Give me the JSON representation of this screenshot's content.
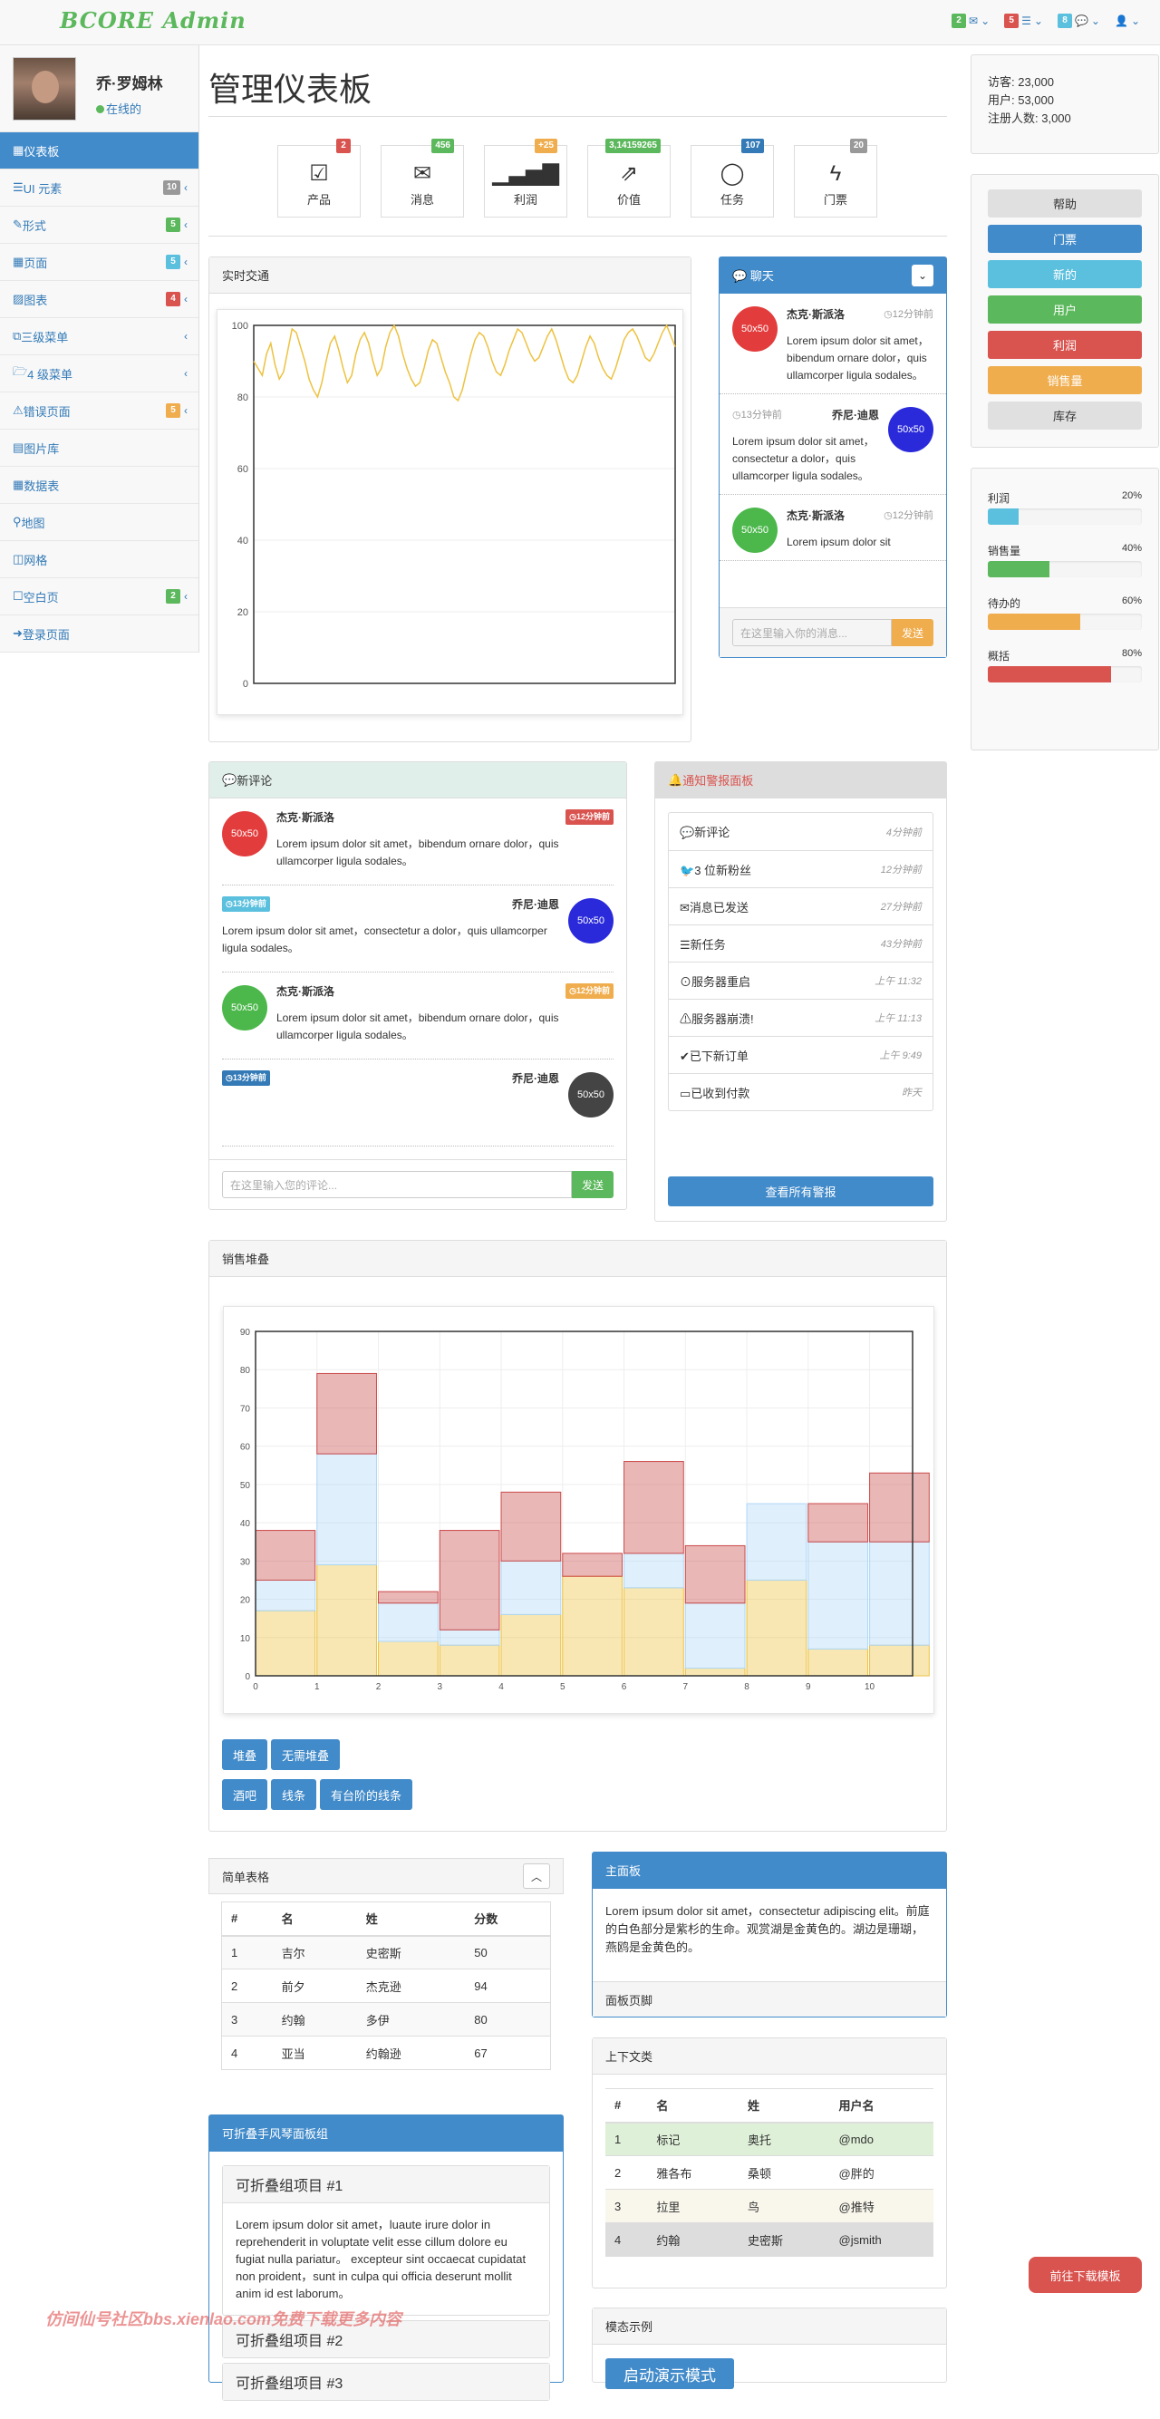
{
  "brand": "BCORE Admin",
  "topnav": [
    {
      "badge": "2",
      "color": "green",
      "icon": "envelope-icon"
    },
    {
      "badge": "5",
      "color": "red",
      "icon": "tasks-icon"
    },
    {
      "badge": "8",
      "color": "info",
      "icon": "comments-icon"
    },
    {
      "badge": "",
      "color": "",
      "icon": "user-icon"
    }
  ],
  "user": {
    "name": "乔·罗姆林",
    "status": "在线的"
  },
  "sidebar": [
    {
      "label": "仪表板",
      "icon": "table-icon",
      "active": true,
      "badge": "",
      "chevron": false
    },
    {
      "label": "UI 元素",
      "icon": "tasks-icon",
      "badge": "10",
      "badge_color": "gray",
      "chevron": true
    },
    {
      "label": "形式",
      "icon": "pencil-icon",
      "badge": "5",
      "badge_color": "green",
      "chevron": true
    },
    {
      "label": "页面",
      "icon": "table-icon",
      "badge": "5",
      "badge_color": "info",
      "chevron": true
    },
    {
      "label": "图表",
      "icon": "chart-icon",
      "badge": "4",
      "badge_color": "red",
      "chevron": true
    },
    {
      "label": "三级菜单",
      "icon": "sitemap-icon",
      "badge": "",
      "chevron": true
    },
    {
      "label": "4 级菜单",
      "icon": "folder-icon",
      "badge": "",
      "chevron": true
    },
    {
      "label": "错误页面",
      "icon": "warning-icon",
      "badge": "5",
      "badge_color": "yellow",
      "chevron": true
    },
    {
      "label": "图片库",
      "icon": "film-icon",
      "badge": "",
      "chevron": false
    },
    {
      "label": "数据表",
      "icon": "table-icon",
      "badge": "",
      "chevron": false
    },
    {
      "label": "地图",
      "icon": "map-marker-icon",
      "badge": "",
      "chevron": false
    },
    {
      "label": "网格",
      "icon": "columns-icon",
      "badge": "",
      "chevron": false
    },
    {
      "label": "空白页",
      "icon": "square-icon",
      "badge": "2",
      "badge_color": "green",
      "chevron": true
    },
    {
      "label": "登录页面",
      "icon": "sign-in-icon",
      "badge": "",
      "chevron": false
    }
  ],
  "page_title": "管理仪表板",
  "tiles": [
    {
      "label": "产品",
      "badge": "2",
      "color": "red",
      "icon": "check-icon",
      "glyph": "☑"
    },
    {
      "label": "消息",
      "badge": "456",
      "color": "green",
      "icon": "envelope-icon",
      "glyph": "✉"
    },
    {
      "label": "利润",
      "badge": "+25",
      "color": "yellow",
      "icon": "signal-icon",
      "glyph": "▁▃▅▇"
    },
    {
      "label": "价值",
      "badge": "3,14159265",
      "color": "green",
      "icon": "external-link-icon",
      "glyph": "⇗"
    },
    {
      "label": "任务",
      "badge": "107",
      "color": "blue",
      "icon": "comment-icon",
      "glyph": "◯"
    },
    {
      "label": "门票",
      "badge": "20",
      "color": "gray",
      "icon": "bolt-icon",
      "glyph": "ϟ"
    }
  ],
  "stats": {
    "visits": "访客: 23,000",
    "users": "用户: 53,000",
    "registered": "注册人数: 3,000"
  },
  "right_buttons": [
    {
      "label": "帮助",
      "color": "default"
    },
    {
      "label": "门票",
      "color": "blue"
    },
    {
      "label": "新的",
      "color": "info"
    },
    {
      "label": "用户",
      "color": "green"
    },
    {
      "label": "利润",
      "color": "red"
    },
    {
      "label": "销售量",
      "color": "yellow"
    },
    {
      "label": "库存",
      "color": "default"
    }
  ],
  "progress": [
    {
      "label": "利润",
      "value": 20,
      "text": "20%",
      "color": "#5bc0de"
    },
    {
      "label": "销售量",
      "value": 40,
      "text": "40%",
      "color": "#5cb85c"
    },
    {
      "label": "待办的",
      "value": 60,
      "text": "60%",
      "color": "#f0ad4e"
    },
    {
      "label": "概括",
      "value": 80,
      "text": "80%",
      "color": "#d9534f"
    }
  ],
  "realtime": {
    "title": "实时交通",
    "chart_data": {
      "type": "line",
      "title": "实时交通",
      "ylim": [
        0,
        100
      ],
      "yticks": [
        0,
        20,
        40,
        60,
        80,
        100
      ],
      "color": "#edc240",
      "values": [
        90,
        88,
        86,
        92,
        95,
        89,
        85,
        87,
        93,
        99,
        98,
        94,
        90,
        85,
        82,
        80,
        84,
        90,
        95,
        97,
        93,
        88,
        84,
        86,
        92,
        96,
        98,
        95,
        90,
        86,
        88,
        94,
        98,
        100,
        97,
        92,
        88,
        85,
        83,
        84,
        88,
        93,
        96,
        95,
        91,
        87,
        84,
        80,
        79,
        82,
        87,
        92,
        96,
        98,
        97,
        94,
        90,
        87,
        86,
        89,
        93,
        96,
        99,
        98,
        95,
        92,
        90,
        91,
        94,
        97,
        99,
        96,
        92,
        88,
        85,
        84,
        86,
        90,
        94,
        97,
        95,
        91,
        88,
        86,
        85,
        88,
        92,
        96,
        98,
        99,
        97,
        94,
        91,
        90,
        92,
        95,
        98,
        100,
        97,
        94
      ]
    }
  },
  "chat": {
    "title": "聊天",
    "messages": [
      {
        "name": "杰克·斯派洛",
        "time": "12分钟前",
        "text": "Lorem ipsum dolor sit amet，bibendum ornare dolor，quis ullamcorper ligula sodales。",
        "avatar": "50x50",
        "side": "left",
        "color": "red"
      },
      {
        "name": "乔尼·迪恩",
        "time": "13分钟前",
        "text": "Lorem ipsum dolor sit amet，consectetur a dolor，quis ullamcorper ligula sodales。",
        "avatar": "50x50",
        "side": "right",
        "color": "blue"
      },
      {
        "name": "杰克·斯派洛",
        "time": "12分钟前",
        "text": "Lorem ipsum dolor sit",
        "avatar": "50x50",
        "side": "left",
        "color": "green"
      }
    ],
    "input_placeholder": "在这里输入你的消息...",
    "send": "发送"
  },
  "comments": {
    "title": "新评论",
    "items": [
      {
        "name": "杰克·斯派洛",
        "time": "12分钟前",
        "text": "Lorem ipsum dolor sit amet，bibendum ornare dolor，quis ullamcorper ligula sodales。",
        "side": "left",
        "color": "red",
        "badge_color": "red"
      },
      {
        "name": "乔尼·迪恩",
        "time": "13分钟前",
        "text": "Lorem ipsum dolor sit amet，consectetur a dolor，quis ullamcorper ligula sodales。",
        "side": "right",
        "color": "blue",
        "badge_color": "info"
      },
      {
        "name": "杰克·斯派洛",
        "time": "12分钟前",
        "text": "Lorem ipsum dolor sit amet，bibendum ornare dolor，quis ullamcorper ligula sodales。",
        "side": "left",
        "color": "green",
        "badge_color": "yellow"
      },
      {
        "name": "乔尼·迪恩",
        "time": "13分钟前",
        "text": "",
        "side": "right",
        "color": "dark",
        "badge_color": "blue"
      }
    ],
    "input_placeholder": "在这里输入您的评论...",
    "send": "发送"
  },
  "alerts": {
    "title": "通知警报面板",
    "items": [
      {
        "label": "新评论",
        "time": "4分钟前",
        "icon": "comment-icon"
      },
      {
        "label": "3 位新粉丝",
        "time": "12分钟前",
        "icon": "twitter-icon"
      },
      {
        "label": "消息已发送",
        "time": "27分钟前",
        "icon": "envelope-icon"
      },
      {
        "label": "新任务",
        "time": "43分钟前",
        "icon": "tasks-icon"
      },
      {
        "label": "服务器重启",
        "time": "上午 11:32",
        "icon": "upload-icon"
      },
      {
        "label": "服务器崩溃!",
        "time": "上午 11:13",
        "icon": "warning-icon"
      },
      {
        "label": "已下新订单",
        "time": "上午 9:49",
        "icon": "check-icon"
      },
      {
        "label": "已收到付款",
        "time": "昨天",
        "icon": "money-icon"
      }
    ],
    "view_all": "查看所有警报"
  },
  "sales": {
    "title": "销售堆叠",
    "chart_data": {
      "type": "bar",
      "stacked": true,
      "categories": [
        "0",
        "1",
        "2",
        "3",
        "4",
        "5",
        "6",
        "7",
        "8",
        "9",
        "10"
      ],
      "ylim": [
        0,
        90
      ],
      "yticks": [
        0,
        10,
        20,
        30,
        40,
        50,
        60,
        70,
        80,
        90
      ],
      "series": [
        {
          "name": "series1",
          "color": "#edc240",
          "values": [
            17,
            29,
            9,
            8,
            16,
            26,
            23,
            2,
            25,
            7,
            8
          ]
        },
        {
          "name": "series2",
          "color": "#afd8f8",
          "values": [
            8,
            29,
            10,
            4,
            14,
            0,
            9,
            17,
            20,
            28,
            27
          ]
        },
        {
          "name": "series3",
          "color": "#cb4b4b",
          "values": [
            13,
            21,
            3,
            26,
            18,
            6,
            24,
            15,
            0,
            10,
            18
          ]
        }
      ]
    },
    "buttons_row1": [
      "堆叠",
      "无需堆叠"
    ],
    "buttons_row2": [
      "酒吧",
      "线条",
      "有台阶的线条"
    ]
  },
  "simple_table": {
    "title": "简单表格",
    "headers": [
      "#",
      "名",
      "姓",
      "分数"
    ],
    "rows": [
      [
        "1",
        "吉尔",
        "史密斯",
        "50"
      ],
      [
        "2",
        "前夕",
        "杰克逊",
        "94"
      ],
      [
        "3",
        "约翰",
        "多伊",
        "80"
      ],
      [
        "4",
        "亚当",
        "约翰逊",
        "67"
      ]
    ]
  },
  "main_panel": {
    "title": "主面板",
    "body": "Lorem ipsum dolor sit amet，consectetur adipiscing elit。前庭的白色部分是紫杉的生命。观赏湖是金黄色的。湖边是珊瑚，燕鸥是金黄色的。",
    "footer": "面板页脚"
  },
  "context_table": {
    "title": "上下文类",
    "headers": [
      "#",
      "名",
      "姓",
      "用户名"
    ],
    "rows": [
      [
        "1",
        "标记",
        "奥托",
        "@mdo"
      ],
      [
        "2",
        "雅各布",
        "桑顿",
        "@胖的"
      ],
      [
        "3",
        "拉里",
        "鸟",
        "@推特"
      ],
      [
        "4",
        "约翰",
        "史密斯",
        "@jsmith"
      ]
    ]
  },
  "accordion": {
    "title": "可折叠手风琴面板组",
    "items": [
      {
        "title": "可折叠组项目 #1",
        "body": "Lorem ipsum dolor sit amet，luaute irure dolor in reprehenderit in voluptate velit esse cillum dolore eu fugiat nulla pariatur。 excepteur sint occaecat cupidatat non proident，sunt in culpa qui officia deserunt mollit anim id est laborum。"
      },
      {
        "title": "可折叠组项目 #2",
        "body": ""
      },
      {
        "title": "可折叠组项目 #3",
        "body": ""
      }
    ]
  },
  "modal": {
    "title": "模态示例",
    "button": "启动演示模式"
  },
  "download_button": "前往下载模板",
  "watermark": "仿间仙号社区bbs.xienlao.com免费下载更多内容"
}
